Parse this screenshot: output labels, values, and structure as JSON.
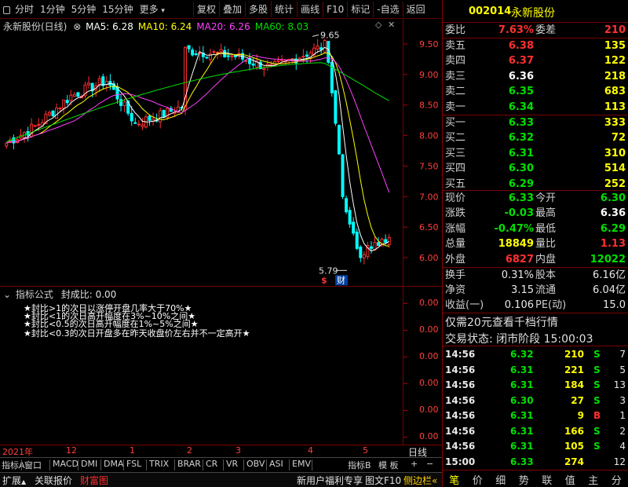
{
  "toolbar": {
    "periods": [
      "分时",
      "1分钟",
      "5分钟",
      "15分钟",
      "更多"
    ],
    "actions": [
      "复权",
      "叠加",
      "多股",
      "统计",
      "画线",
      "F10",
      "标记",
      "-自选",
      "返回"
    ]
  },
  "chart": {
    "title": "永新股份(日线)",
    "ma": [
      {
        "label": "MA5: 6.28",
        "color": "#ffffff"
      },
      {
        "label": "MA10: 6.24",
        "color": "#ffff00"
      },
      {
        "label": "MA20: 6.26",
        "color": "#ff40ff"
      },
      {
        "label": "MA60: 8.03",
        "color": "#00e000"
      }
    ],
    "price_ticks": [
      "9.50",
      "9.00",
      "8.50",
      "8.00",
      "7.50",
      "7.00",
      "6.50",
      "6.00"
    ],
    "high_label": "9.65",
    "low_label": "5.79",
    "badges": [
      "$",
      "财"
    ],
    "colors": {
      "up": "#ff3030",
      "down": "#00ffff",
      "ma5": "#ffffff",
      "ma10": "#ffff00",
      "ma20": "#ff40ff",
      "ma60": "#00e000"
    }
  },
  "indicator": {
    "title": "指标公式",
    "value_label": "封成比: 0.00",
    "ticks": [
      "0.00",
      "0.00",
      "0.00",
      "0.00",
      "0.00",
      "0.00"
    ],
    "notes": [
      "★封比>1的次日以涨停开盘几率大于70%★",
      "★封比<1的次日高开幅度在3%~10%之间★",
      "★封比<0.5的次日高开幅度在1%~5%之间★",
      "★封比<0.3的次日开盘多在昨天收盘价左右并不一定高开★"
    ]
  },
  "timeline": {
    "year": "2021年",
    "months": [
      "12",
      "1",
      "2",
      "3",
      "4",
      "5"
    ],
    "right_label": "日线"
  },
  "indicator_tabs": {
    "left": [
      "指标A",
      "窗口",
      "MACD",
      "DMI",
      "DMA",
      "FSL",
      "TRIX",
      "BRAR",
      "CR",
      "VR",
      "OBV",
      "ASI",
      "EMV"
    ],
    "right": [
      "指标B",
      "模 板",
      "+",
      "−"
    ]
  },
  "bottom_bar": {
    "left": [
      "扩展",
      "关联报价",
      "财富图"
    ],
    "right": [
      "新用户福利专享",
      "图文F10",
      "侧边栏«"
    ]
  },
  "quote": {
    "code": "002014",
    "name": "永新股份",
    "weibi_label": "委比",
    "weibi": "7.63%",
    "weicha_label": "委差",
    "weicha": "210",
    "asks": [
      {
        "label": "卖五",
        "price": "6.38",
        "vol": "135",
        "pc": "red"
      },
      {
        "label": "卖四",
        "price": "6.37",
        "vol": "122",
        "pc": "red"
      },
      {
        "label": "卖三",
        "price": "6.36",
        "vol": "218",
        "pc": "white"
      },
      {
        "label": "卖二",
        "price": "6.35",
        "vol": "683",
        "pc": "green"
      },
      {
        "label": "卖一",
        "price": "6.34",
        "vol": "113",
        "pc": "green"
      }
    ],
    "bids": [
      {
        "label": "买一",
        "price": "6.33",
        "vol": "333",
        "pc": "green"
      },
      {
        "label": "买二",
        "price": "6.32",
        "vol": "72",
        "pc": "green"
      },
      {
        "label": "买三",
        "price": "6.31",
        "vol": "310",
        "pc": "green"
      },
      {
        "label": "买四",
        "price": "6.30",
        "vol": "514",
        "pc": "green"
      },
      {
        "label": "买五",
        "price": "6.29",
        "vol": "252",
        "pc": "green"
      }
    ],
    "stats": [
      {
        "l1": "现价",
        "v1": "6.33",
        "c1": "green",
        "l2": "今开",
        "v2": "6.30",
        "c2": "green"
      },
      {
        "l1": "涨跌",
        "v1": "-0.03",
        "c1": "green",
        "l2": "最高",
        "v2": "6.36",
        "c2": "white"
      },
      {
        "l1": "涨幅",
        "v1": "-0.47%",
        "c1": "green",
        "l2": "最低",
        "v2": "6.29",
        "c2": "green"
      },
      {
        "l1": "总量",
        "v1": "18849",
        "c1": "yellow",
        "l2": "量比",
        "v2": "1.13",
        "c2": "red"
      },
      {
        "l1": "外盘",
        "v1": "6827",
        "c1": "red",
        "l2": "内盘",
        "v2": "12022",
        "c2": "green"
      }
    ],
    "stats2": [
      {
        "l1": "换手",
        "v1": "0.31%",
        "l2": "股本",
        "v2": "6.16亿"
      },
      {
        "l1": "净资",
        "v1": "3.15",
        "l2": "流通",
        "v2": "6.04亿"
      },
      {
        "l1": "收益(一)",
        "v1": "0.106",
        "l2": "PE(动)",
        "v2": "15.0"
      }
    ],
    "promo": "仅需20元查看千档行情",
    "status": "交易状态: 闭市阶段 15:00:03",
    "ticks": [
      {
        "t": "14:56",
        "p": "6.32",
        "v": "210",
        "d": "S",
        "dc": "green",
        "n": "7"
      },
      {
        "t": "14:56",
        "p": "6.31",
        "v": "221",
        "d": "S",
        "dc": "green",
        "n": "5"
      },
      {
        "t": "14:56",
        "p": "6.31",
        "v": "184",
        "d": "S",
        "dc": "green",
        "n": "13"
      },
      {
        "t": "14:56",
        "p": "6.30",
        "v": "27",
        "d": "S",
        "dc": "green",
        "n": "3"
      },
      {
        "t": "14:56",
        "p": "6.31",
        "v": "9",
        "d": "B",
        "dc": "red",
        "n": "1"
      },
      {
        "t": "14:56",
        "p": "6.31",
        "v": "166",
        "d": "S",
        "dc": "green",
        "n": "2"
      },
      {
        "t": "14:56",
        "p": "6.31",
        "v": "105",
        "d": "S",
        "dc": "green",
        "n": "4"
      },
      {
        "t": "15:00",
        "p": "6.33",
        "v": "274",
        "d": "",
        "dc": "green",
        "n": "12"
      }
    ],
    "tabs": [
      "笔",
      "价",
      "细",
      "势",
      "联",
      "值",
      "主",
      "分"
    ]
  }
}
